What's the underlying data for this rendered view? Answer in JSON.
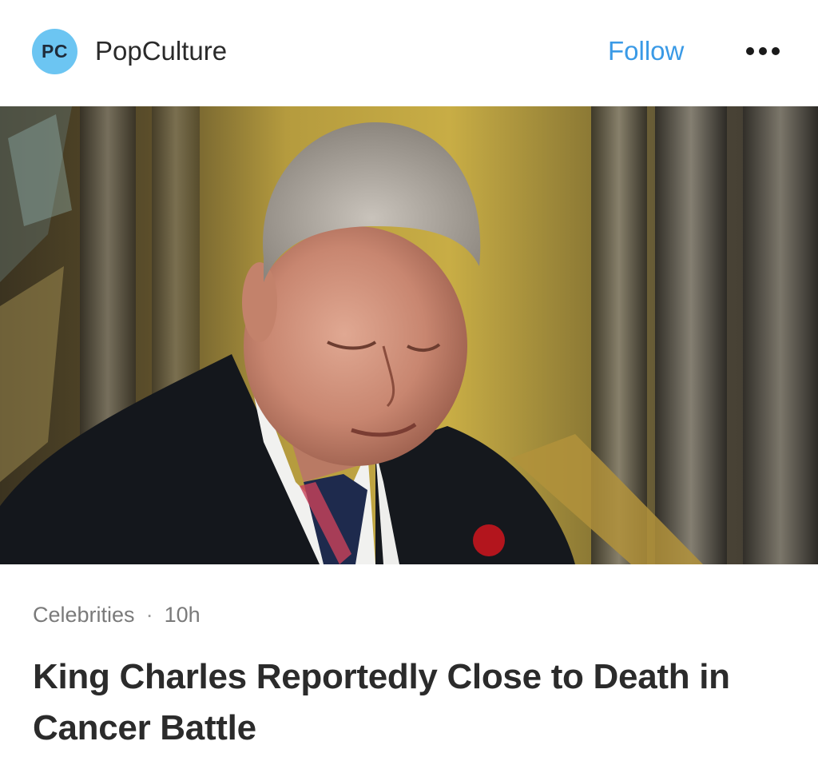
{
  "source": {
    "avatar_initials": "PC",
    "name": "PopCulture",
    "avatar_color": "#6cc5f2"
  },
  "header": {
    "follow_label": "Follow",
    "more_icon": "ellipsis-horizontal-icon",
    "follow_color": "#3a9ae6"
  },
  "article": {
    "image_alt": "King Charles looking down, wearing a dark coat, white shirt, striped tie and red poppy",
    "category": "Celebrities",
    "separator": "·",
    "age": "10h",
    "headline": "King Charles Reportedly Close to Death in Cancer Battle"
  }
}
